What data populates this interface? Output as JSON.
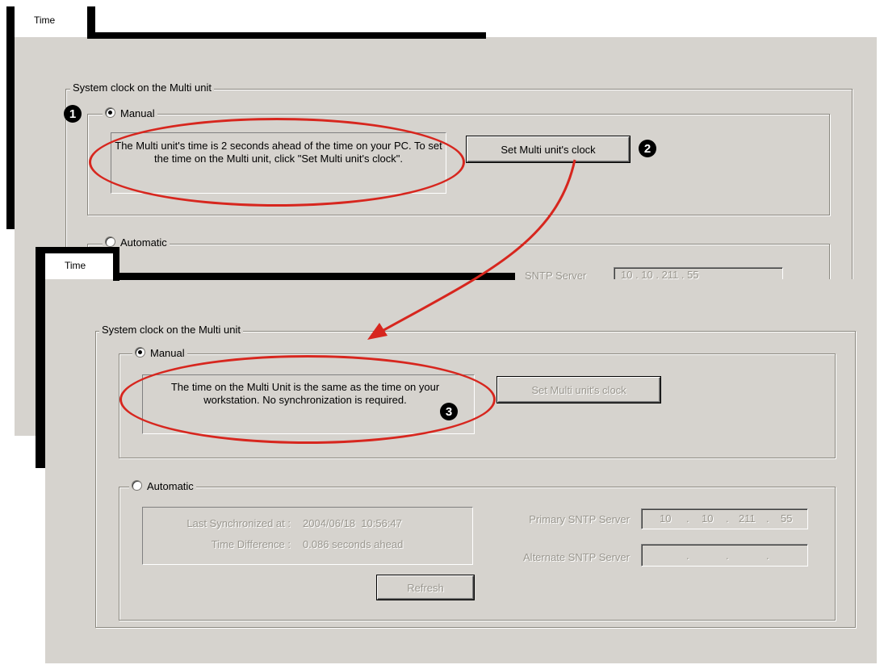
{
  "top_window": {
    "tab_label": "Time",
    "group_title": "System clock on the Multi unit",
    "manual_label": "Manual",
    "message": "The Multi unit's time is 2 seconds ahead of the time on your PC. To set the time on the Multi unit, click \"Set Multi unit's clock\".",
    "set_clock_button": "Set Multi unit's clock",
    "automatic_label": "Automatic",
    "partial_sntp_text": "SNTP Server",
    "partial_ip": "10 . 10 . 211 . 55"
  },
  "bottom_window": {
    "tab_label": "Time",
    "group_title": "System clock on the Multi unit",
    "manual_label": "Manual",
    "message": "The time on the Multi Unit is the same as the time on your workstation.  No synchronization is required.",
    "set_clock_button": "Set Multi unit's clock",
    "automatic_label": "Automatic",
    "last_sync_label": "Last Synchronized at :",
    "last_sync_value": "2004/06/18  10:56:47",
    "time_diff_label": "Time Difference :",
    "time_diff_value": "0.086 seconds ahead",
    "refresh_button": "Refresh",
    "primary_sntp_label": "Primary SNTP Server",
    "primary_ip": [
      "10",
      "10",
      "211",
      "55"
    ],
    "alternate_sntp_label": "Alternate SNTP Server",
    "alternate_ip": [
      "",
      "",
      "",
      ""
    ]
  },
  "callouts": {
    "step1": "1",
    "step2": "2",
    "step3": "3",
    "color": "#d7261e"
  }
}
